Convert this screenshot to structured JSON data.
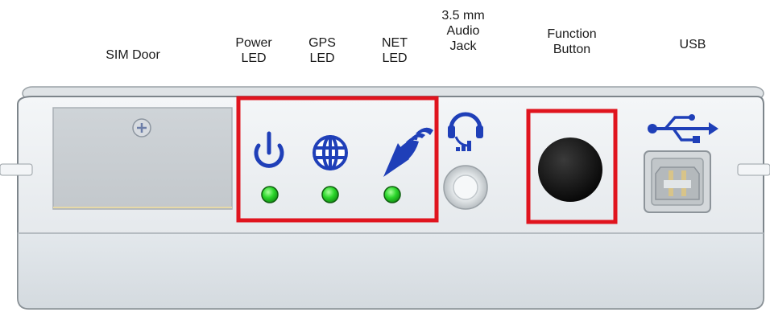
{
  "labels": {
    "sim_door": "SIM Door",
    "power_led": [
      "Power",
      "LED"
    ],
    "gps_led": [
      "GPS",
      "LED"
    ],
    "net_led": [
      "NET",
      "LED"
    ],
    "audio_jack": [
      "3.5 mm",
      "Audio",
      "Jack"
    ],
    "function_button": [
      "Function",
      "Button"
    ],
    "usb": "USB"
  },
  "icons": {
    "power": "power-icon",
    "gps": "globe-icon",
    "net": "satellite-dish-icon",
    "audio": "headset-icon",
    "usb": "usb-icon",
    "sim_screw": "screw-icon"
  },
  "colors": {
    "highlight": "#e0141e",
    "icon_blue": "#1f3fb8",
    "led_green": "#2bd62b",
    "body_grey": "#e9edf0",
    "button_black": "#111111"
  },
  "led_status": [
    "on",
    "on",
    "on"
  ]
}
